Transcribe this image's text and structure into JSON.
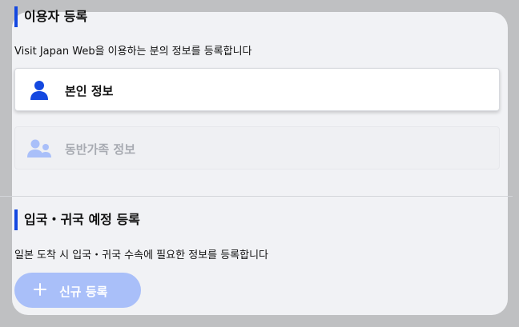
{
  "registration": {
    "user_section": {
      "title": "이용자 등록",
      "description": "Visit Japan Web을 이용하는 분의 정보를 등록합니다",
      "cards": [
        {
          "label": "본인 정보",
          "icon": "person-icon",
          "state": "active"
        },
        {
          "label": "동반가족 정보",
          "icon": "family-icon",
          "state": "disabled"
        }
      ]
    },
    "entry_section": {
      "title": "입국・귀국 예정 등록",
      "description": "일본 도착 시 입국・귀국 수속에 필요한 정보를 등록합니다",
      "new_button_label": "신규 등록"
    }
  },
  "colors": {
    "accent": "#1448e0",
    "icon_active": "#1448e0",
    "icon_disabled": "#a9bff9",
    "button_disabled": "#a9bff9",
    "panel_bg": "#f1f2f5",
    "page_bg": "#bfc0c2"
  }
}
